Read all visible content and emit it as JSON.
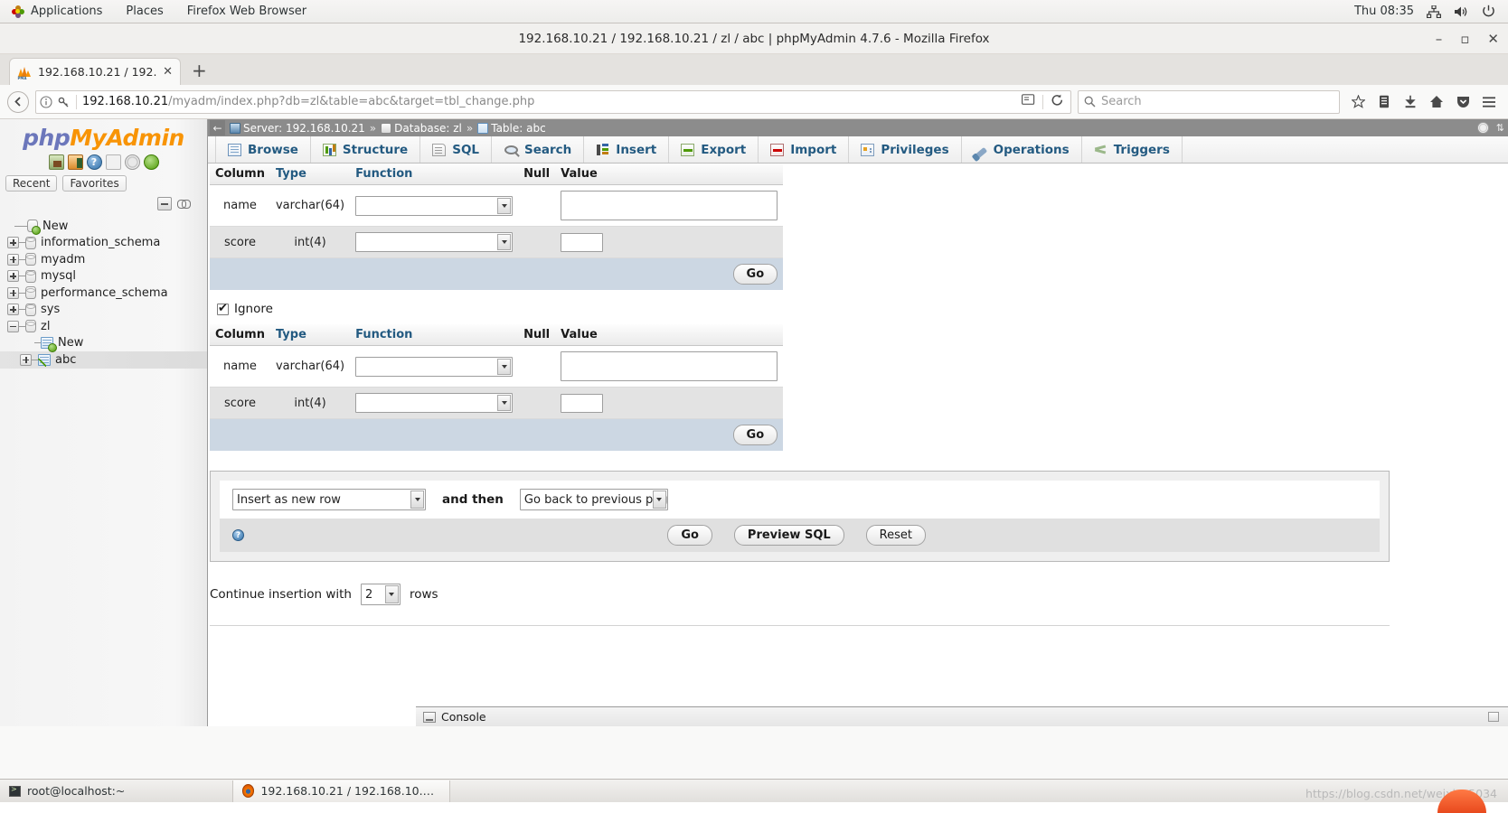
{
  "desktop": {
    "menu": [
      "Applications",
      "Places",
      "Firefox Web Browser"
    ],
    "clock": "Thu 08:35",
    "tray_icons": [
      "network-icon",
      "volume-icon",
      "power-icon"
    ]
  },
  "browser": {
    "window_title": "192.168.10.21 / 192.168.10.21 / zl / abc | phpMyAdmin 4.7.6 - Mozilla Firefox",
    "window_buttons": {
      "minimize": "–",
      "maximize": "▫",
      "close": "✕"
    },
    "tab": {
      "title": "192.168.10.21 / 192.1...",
      "close": "✕",
      "favicon": "phpmyadmin-favicon"
    },
    "new_tab_label": "+",
    "url_host": "192.168.10.21",
    "url_path": "/myadm/index.php?db=zl&table=abc&target=tbl_change.php",
    "search_placeholder": "Search",
    "toolbar_icons": [
      "back-icon",
      "page-info-icon",
      "permissions-key-icon",
      "reader-view-icon",
      "reload-icon",
      "bookmark-star-icon",
      "library-icon",
      "downloads-icon",
      "home-icon",
      "pocket-icon",
      "hamburger-menu-icon"
    ]
  },
  "navigation": {
    "logo": {
      "php": "php",
      "my": "My",
      "admin": "Admin"
    },
    "quick_icons": [
      "home-icon",
      "logout-icon",
      "help-icon",
      "docs-icon",
      "settings-gear-icon",
      "reload-navigation-icon"
    ],
    "pills": [
      "Recent",
      "Favorites"
    ],
    "tools": [
      "collapse-all-icon",
      "link-with-main-panel-icon"
    ],
    "tree": [
      {
        "label": "New",
        "type": "new-database",
        "toggle": "none",
        "depth": 0,
        "selected": false
      },
      {
        "label": "information_schema",
        "type": "database",
        "toggle": "plus",
        "depth": 0,
        "selected": false
      },
      {
        "label": "myadm",
        "type": "database",
        "toggle": "plus",
        "depth": 0,
        "selected": false
      },
      {
        "label": "mysql",
        "type": "database",
        "toggle": "plus",
        "depth": 0,
        "selected": false
      },
      {
        "label": "performance_schema",
        "type": "database",
        "toggle": "plus",
        "depth": 0,
        "selected": false
      },
      {
        "label": "sys",
        "type": "database",
        "toggle": "plus",
        "depth": 0,
        "selected": false
      },
      {
        "label": "zl",
        "type": "database",
        "toggle": "minus",
        "depth": 0,
        "selected": false
      },
      {
        "label": "New",
        "type": "new-table",
        "toggle": "none",
        "depth": 1,
        "selected": false
      },
      {
        "label": "abc",
        "type": "table",
        "toggle": "plus",
        "depth": 1,
        "selected": true
      }
    ]
  },
  "main": {
    "breadcrumb": {
      "back": "←",
      "server_label": "Server: 192.168.10.21",
      "database_label": "Database: zl",
      "table_label": "Table: abc",
      "separator": "»",
      "right_icons": [
        "settings-gear-icon",
        "collapse-panel-icon"
      ]
    },
    "tabs": [
      {
        "label": "Browse",
        "icon": "browse-icon"
      },
      {
        "label": "Structure",
        "icon": "structure-icon"
      },
      {
        "label": "SQL",
        "icon": "sql-icon"
      },
      {
        "label": "Search",
        "icon": "search-icon"
      },
      {
        "label": "Insert",
        "icon": "insert-icon"
      },
      {
        "label": "Export",
        "icon": "export-icon"
      },
      {
        "label": "Import",
        "icon": "import-icon"
      },
      {
        "label": "Privileges",
        "icon": "privileges-icon"
      },
      {
        "label": "Operations",
        "icon": "operations-icon"
      },
      {
        "label": "Triggers",
        "icon": "triggers-icon"
      }
    ],
    "insert_table_headers": [
      "Column",
      "Type",
      "Function",
      "Null",
      "Value"
    ],
    "insert_rows_1": [
      {
        "column": "name",
        "type": "varchar(64)",
        "function": "",
        "null": "",
        "value": "",
        "value_size": "large"
      },
      {
        "column": "score",
        "type": "int(4)",
        "function": "",
        "null": "",
        "value": "",
        "value_size": "small"
      }
    ],
    "insert_rows_2": [
      {
        "column": "name",
        "type": "varchar(64)",
        "function": "",
        "null": "",
        "value": "",
        "value_size": "large"
      },
      {
        "column": "score",
        "type": "int(4)",
        "function": "",
        "null": "",
        "value": "",
        "value_size": "small"
      }
    ],
    "go_label": "Go",
    "ignore": {
      "label": "Ignore",
      "checked": true
    },
    "action_panel": {
      "insert_mode": "Insert as new row",
      "and_then_label": "and then",
      "after_action": "Go back to previous page",
      "help_icon": "help-icon",
      "buttons": [
        "Go",
        "Preview SQL",
        "Reset"
      ]
    },
    "continue_insertion": {
      "prefix": "Continue insertion with",
      "rows": "2",
      "suffix": "rows"
    },
    "console": {
      "label": "Console",
      "icon": "console-icon"
    }
  },
  "taskbar": {
    "items": [
      {
        "label": "root@localhost:~",
        "icon": "terminal-icon"
      },
      {
        "label": "192.168.10.21 / 192.168.10.21 / z...",
        "icon": "firefox-icon"
      }
    ],
    "watermark": "https://blog.csdn.net/weixin_5034"
  }
}
